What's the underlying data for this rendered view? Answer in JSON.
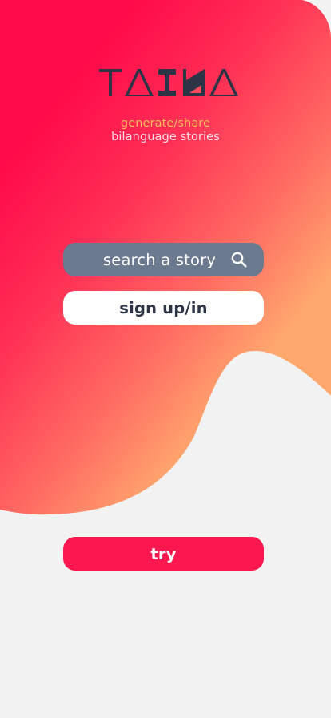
{
  "app": {
    "logo_text": "TAIKA",
    "tagline_line1": "generate/share",
    "tagline_line2": "bilanguage stories"
  },
  "actions": {
    "search_label": "search a story",
    "search_icon": "search-icon",
    "signup_label": "sign up/in",
    "try_label": "try"
  },
  "colors": {
    "gradient_start": "#ff0a4a",
    "gradient_end": "#ffa66e",
    "logo": "#2d3446",
    "tagline_accent": "#ffc05c",
    "search_button": "#6b7a8f",
    "try_button": "#fc174f",
    "background": "#f2f2f2"
  }
}
